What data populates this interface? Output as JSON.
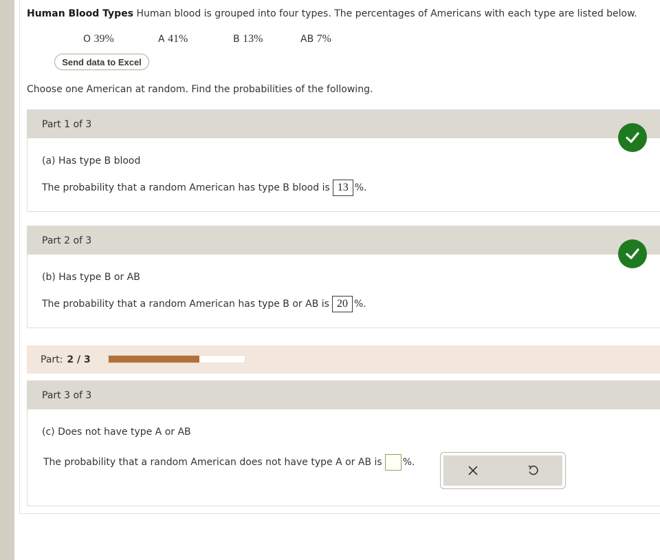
{
  "header": {
    "title": "Human Blood Types",
    "description": "Human blood is grouped into four types. The percentages of Americans with each type are listed below."
  },
  "blood_types": [
    {
      "label": "O",
      "value": "39%"
    },
    {
      "label": "A",
      "value": "41%"
    },
    {
      "label": "B",
      "value": "13%"
    },
    {
      "label": "AB",
      "value": "7%"
    }
  ],
  "excel_button": "Send data to Excel",
  "instruction": "Choose one American at random. Find the probabilities of the following.",
  "parts": [
    {
      "header": "Part 1 of 3",
      "question": "(a) Has type B blood",
      "answer_prefix": "The probability that a random American has type B blood is",
      "answer": "13",
      "answer_suffix": "%.",
      "status": "correct"
    },
    {
      "header": "Part 2 of 3",
      "question": "(b) Has type B or AB",
      "answer_prefix": "The probability that a random American has type B or AB is",
      "answer": "20",
      "answer_suffix": "%.",
      "status": "correct"
    },
    {
      "header": "Part 3 of 3",
      "question": "(c) Does not have type A or AB",
      "answer_prefix": "The probability that a random American does not have type A or AB is",
      "answer": "",
      "answer_suffix": "%."
    }
  ],
  "progress": {
    "label": "Part:",
    "count": "2 / 3",
    "fraction": 0.667
  },
  "tools": {
    "clear_icon": "x-icon",
    "undo_icon": "undo-icon"
  },
  "colors": {
    "correct": "#1f7a1f",
    "progress_fill": "#b2703b",
    "part_header": "#dcd9d1"
  }
}
